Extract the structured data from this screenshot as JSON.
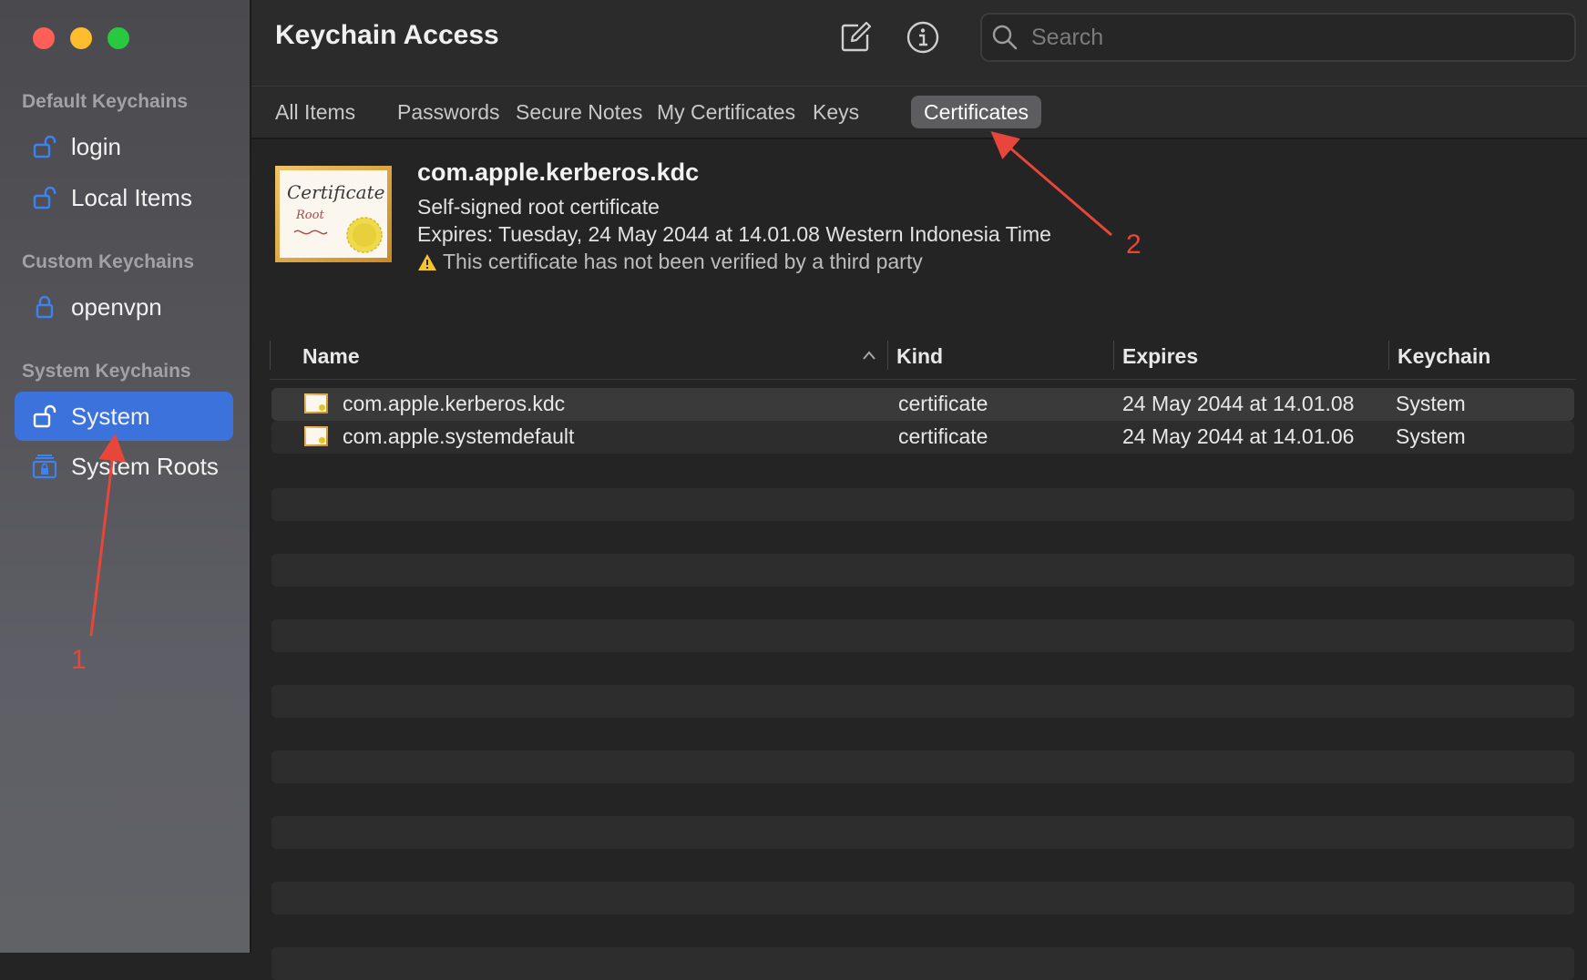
{
  "app": {
    "title": "Keychain Access"
  },
  "toolbar": {
    "compose_icon": "compose-icon",
    "info_icon": "info-icon",
    "search_placeholder": "Search"
  },
  "sidebar": {
    "sections": [
      {
        "title": "Default Keychains",
        "items": [
          {
            "label": "login",
            "icon": "unlock-icon"
          },
          {
            "label": "Local Items",
            "icon": "unlock-icon"
          }
        ]
      },
      {
        "title": "Custom Keychains",
        "items": [
          {
            "label": "openvpn",
            "icon": "lock-icon"
          }
        ]
      },
      {
        "title": "System Keychains",
        "items": [
          {
            "label": "System",
            "icon": "unlock-icon",
            "selected": true
          },
          {
            "label": "System Roots",
            "icon": "cabinet-lock-icon"
          }
        ]
      }
    ]
  },
  "tabs": [
    {
      "label": "All Items"
    },
    {
      "label": "Passwords"
    },
    {
      "label": "Secure Notes"
    },
    {
      "label": "My Certificates"
    },
    {
      "label": "Keys"
    },
    {
      "label": "Certificates",
      "active": true
    }
  ],
  "detail": {
    "cert_image_title": "Certificate",
    "cert_image_sub": "Root",
    "name": "com.apple.kerberos.kdc",
    "type": "Self-signed root certificate",
    "expires": "Expires: Tuesday, 24 May 2044 at 14.01.08 Western Indonesia Time",
    "warning": "This certificate has not been verified by a third party"
  },
  "table": {
    "columns": [
      "Name",
      "Kind",
      "Expires",
      "Keychain"
    ],
    "rows": [
      {
        "name": "com.apple.kerberos.kdc",
        "kind": "certificate",
        "expires": "24 May 2044 at 14.01.08",
        "keychain": "System"
      },
      {
        "name": "com.apple.systemdefault",
        "kind": "certificate",
        "expires": "24 May 2044 at 14.01.06",
        "keychain": "System"
      }
    ]
  },
  "annotations": [
    {
      "label": "1"
    },
    {
      "label": "2"
    }
  ],
  "colors": {
    "accent": "#3b72dc",
    "annotation": "#e8463a"
  }
}
